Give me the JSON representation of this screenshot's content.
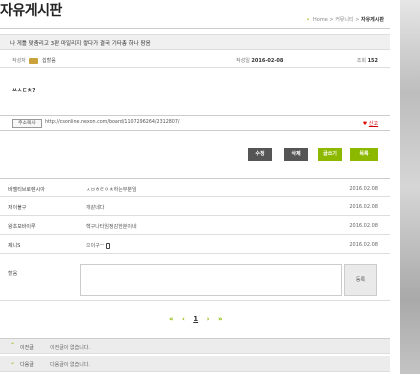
{
  "board": {
    "title": "자유게시판",
    "breadcrumb": {
      "home": "Home",
      "sep1": ">",
      "community": "커뮤니티",
      "sep2": ">",
      "current": "자유게시판"
    }
  },
  "post": {
    "title": "나 게틀 맞춤리고 3판 마일리지 쌓다가 결국 기타총 하나 팜음",
    "writer_label": "작성자",
    "writer_name": "쉽할음",
    "date_label": "작성일",
    "date": "2016-02-08",
    "views_label": "조회",
    "views": "152",
    "body": "ㅆㅅㄷㅊ?"
  },
  "url_bar": {
    "copy_label": "주소복사",
    "url": "http://csonline.nexon.com/board/1107296264/2312807/",
    "report_heart": "♥",
    "report_label": "신고"
  },
  "actions": {
    "edit": "수정",
    "delete": "삭제",
    "write": "글쓰기",
    "list": "목록"
  },
  "comments": [
    {
      "name": "바젤티브로렌시아",
      "text": "ㅅㅂㅎㅌㅇㅊ하는부분임",
      "date": "2016.02.08",
      "phone": false
    },
    {
      "name": "저이불구",
      "text": "개같네다",
      "date": "2016.02.08",
      "phone": false
    },
    {
      "name": "왕초보바이루",
      "text": "헥구나타임정감한분이네",
      "date": "2016.02.08",
      "phone": false
    },
    {
      "name": "제니S",
      "text": "으이구ㅡ",
      "date": "2016.02.08",
      "phone": true
    }
  ],
  "reply": {
    "label": "할음",
    "submit": "등록"
  },
  "pager": {
    "first": "«",
    "prev": "‹",
    "current": "1",
    "next": "›",
    "last": "»"
  },
  "nav": {
    "prev_label": "이전글",
    "prev_text": "이전글이 없습니다.",
    "next_label": "다음글",
    "next_text": "다음글이 없습니다."
  },
  "colors": {
    "accent": "#8cb800",
    "dark_button": "#555555",
    "report": "#cc0000"
  }
}
